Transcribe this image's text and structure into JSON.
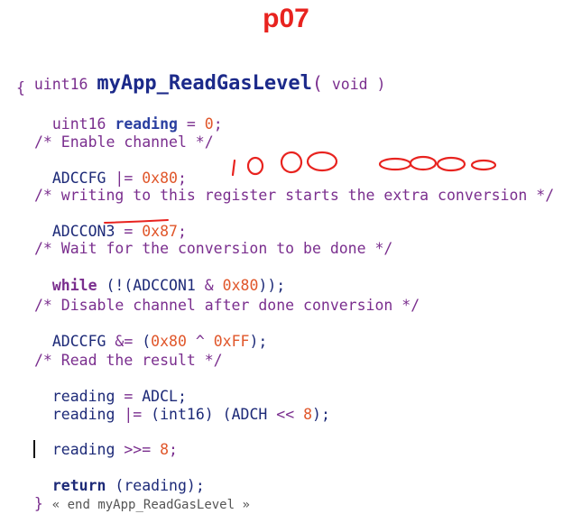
{
  "page_title": "p07",
  "sig": {
    "type": "uint16",
    "name": "myApp_ReadGasLevel",
    "open": "(",
    "arg": "void",
    "close": ")"
  },
  "brace_open": "{",
  "decl": {
    "type": "uint16",
    "var": "reading",
    "eq": "=",
    "val": "0",
    "semi": ";"
  },
  "c1": "/* Enable channel */",
  "s1": {
    "lhs": "ADCCFG",
    "op": "|=",
    "val": "0x80",
    "semi": ";"
  },
  "handwriting": {
    "num1": "1000",
    "num2": "0000"
  },
  "c2": "/* writing to this register starts the extra conversion */",
  "s2": {
    "lhs": "ADCCON3",
    "op": "=",
    "val": "0x87",
    "semi": ";"
  },
  "c3": "/* Wait for the conversion to be done */",
  "s3": {
    "kw": "while",
    "p1": "(!(",
    "reg": "ADCCON1",
    "op": "&",
    "val": "0x80",
    "p2": "));"
  },
  "c4": "/* Disable channel after done conversion */",
  "s4": {
    "lhs": "ADCCFG",
    "op": "&=",
    "p1": "(",
    "v1": "0x80",
    "x": "^",
    "v2": "0xFF",
    "p2": ");"
  },
  "c5": "/* Read the result */",
  "s5": {
    "lhs": "reading",
    "op": "=",
    "rhs": "ADCL;"
  },
  "s6": {
    "lhs": "reading",
    "op": "|=",
    "cast": "(int16)",
    "p1": "(ADCH",
    "sh": "<<",
    "val": "8",
    "p2": ");"
  },
  "s7": {
    "lhs": "reading",
    "op": ">>=",
    "val": "8",
    "semi": ";"
  },
  "s8": {
    "kw": "return",
    "expr": "(reading);"
  },
  "closing": {
    "brace": "}",
    "note": "« end myApp_ReadGasLevel »"
  },
  "colors": {
    "title": "#e8231f",
    "ink": "#e8231f"
  }
}
